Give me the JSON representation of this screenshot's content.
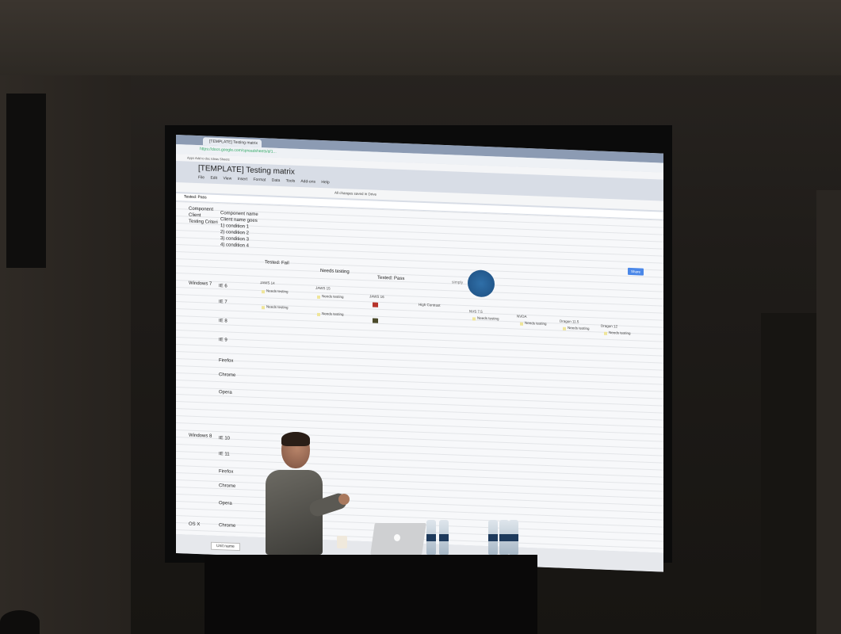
{
  "browser": {
    "tab_title": "[TEMPLATE] Testing matrix",
    "url": "https://docs.google.com/spreadsheets/d/1...",
    "bookmarks": "Apps   Add to doc   Ideas   Sheets"
  },
  "doc": {
    "title": "[TEMPLATE] Testing matrix",
    "menus": "File Edit View Insert Format Data Tools Add-ons Help",
    "status": "All changes saved in Drive",
    "formula": "Tested: Pass",
    "share_label": "Share"
  },
  "sheet": {
    "header_rows": [
      {
        "label": "Component",
        "value": "Component name"
      },
      {
        "label": "Client",
        "value": "Client name goes"
      },
      {
        "label": "Testing Criteri",
        "value": "1) condition 1"
      }
    ],
    "conditions": [
      "2) condition 2",
      "3) condition 3",
      "4) condition 4"
    ],
    "legend": {
      "fail": "Tested: Fail",
      "needs": "Needs testing",
      "pass": "Tested: Pass"
    },
    "logo_text": "simply",
    "os_groups": [
      {
        "name": "Windows 7",
        "browsers": [
          "IE 6",
          "IE 7",
          "IE 8",
          "IE 9",
          "Firefox",
          "Chrome",
          "Opera"
        ]
      },
      {
        "name": "Windows 8",
        "browsers": [
          "IE 10",
          "IE 11",
          "Firefox",
          "Chrome",
          "Opera"
        ]
      },
      {
        "name": "OS X",
        "browsers": [
          "Chrome"
        ]
      }
    ],
    "screenreaders": [
      "JAWS 14",
      "JAWS 15",
      "JAWS 16",
      "High Contrast",
      "NVS 7.5",
      "NVDA",
      "Dragon 11.5",
      "Dragon 12"
    ],
    "cell_text": "Needs testing",
    "sheet_tab": "Unit name"
  }
}
